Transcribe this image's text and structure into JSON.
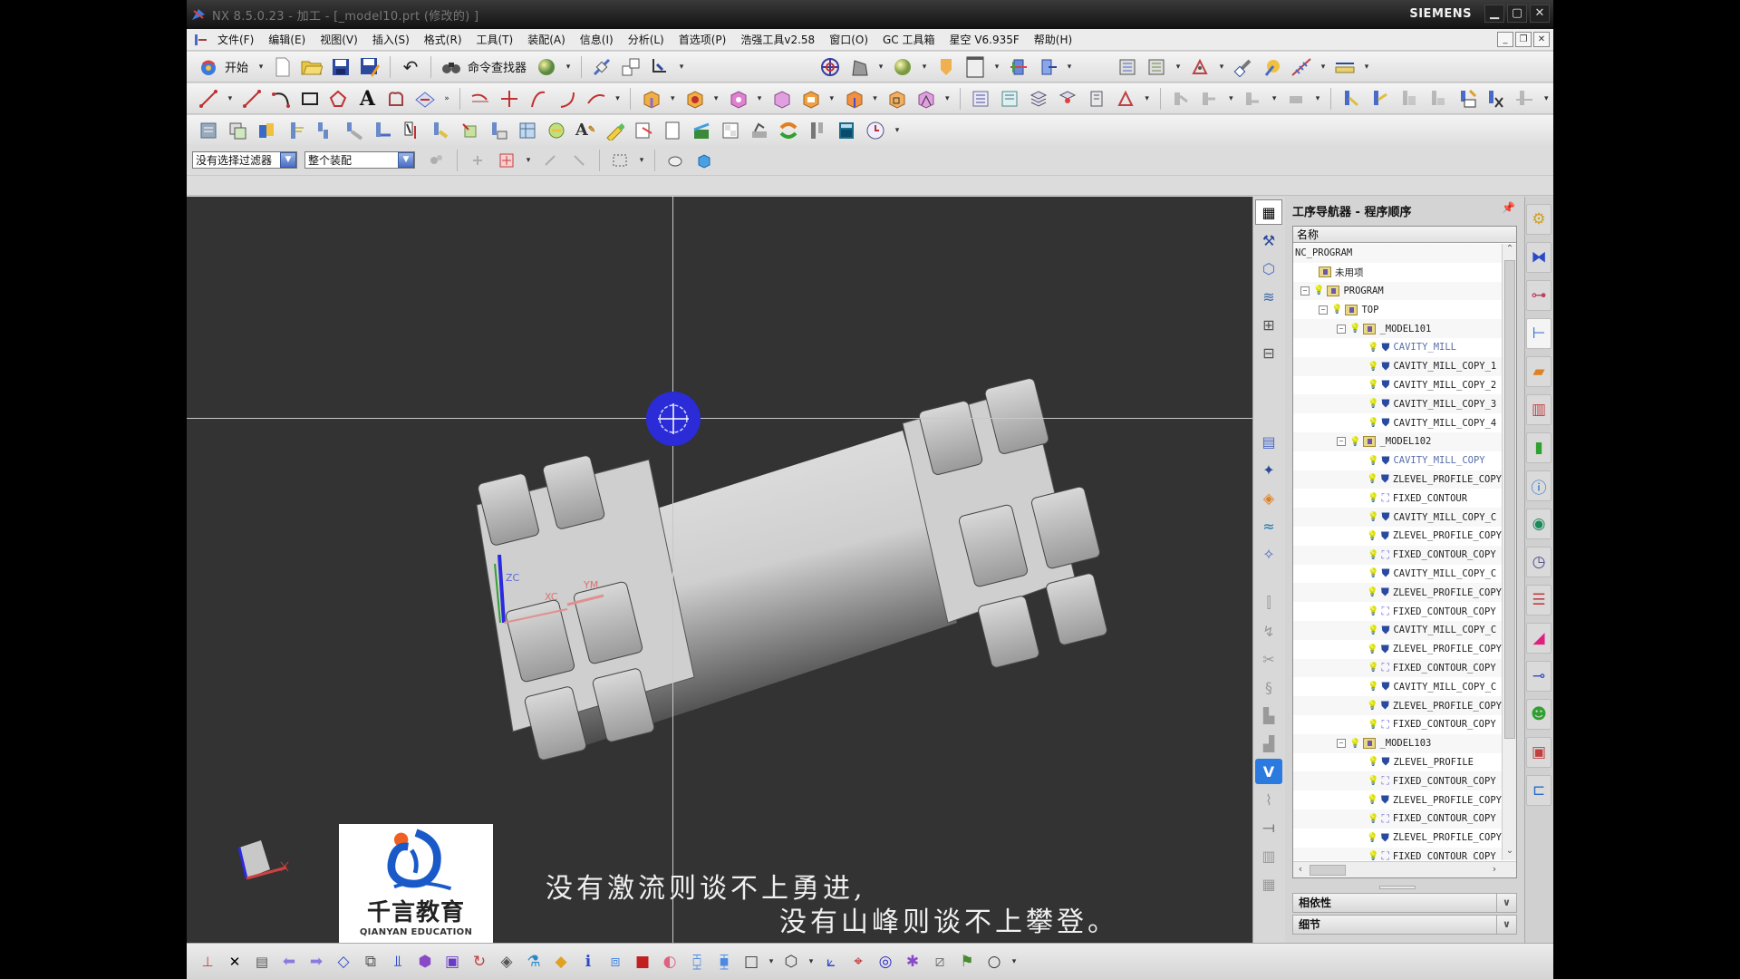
{
  "window": {
    "title": "NX 8.5.0.23 - 加工 - [_model10.prt  (修改的) ]",
    "brand": "SIEMENS",
    "controls": {
      "minimize": "▁",
      "maximize": "▢",
      "close": "✕"
    },
    "doc_controls": {
      "minimize": "_",
      "restore": "❐",
      "close": "✕"
    }
  },
  "menu": {
    "items": [
      "文件(F)",
      "编辑(E)",
      "视图(V)",
      "插入(S)",
      "格式(R)",
      "工具(T)",
      "装配(A)",
      "信息(I)",
      "分析(L)",
      "首选项(P)",
      "浩强工具v2.58",
      "窗口(O)",
      "GC 工具箱",
      "星空 V6.935F",
      "帮助(H)"
    ]
  },
  "toolbar": {
    "start_label": "开始",
    "command_finder_label": "命令查找器",
    "row1_icons": [
      "new-file",
      "open-folder",
      "save",
      "save-as",
      "undo"
    ],
    "row1_right_icons": [
      "rotate-view",
      "render-style",
      "shaded-sphere",
      "background",
      "layer-window",
      "fit-view",
      "section-view",
      "operation-list",
      "tool-list",
      "geometry-view",
      "measure"
    ],
    "row2_icons": [
      "line",
      "line-2",
      "arc",
      "rectangle",
      "polygon",
      "text",
      "offset-curve",
      "project-curve",
      "trim",
      "extend",
      "fillet",
      "curve-edit"
    ],
    "row3_icons": [
      "create-program",
      "create-tool",
      "create-geometry",
      "create-method",
      "create-operation",
      "generate-path",
      "verify",
      "post-process",
      "shop-doc"
    ]
  },
  "filterbar": {
    "selection_filter": "没有选择过滤器",
    "scope": "整个装配"
  },
  "viewport": {
    "subtitle_line1": "没有激流则谈不上勇进,",
    "subtitle_line2": "没有山峰则谈不上攀登。",
    "logo_cn": "千言教育",
    "logo_en": "QIANYAN EDUCATION",
    "axis_labels": {
      "zc": "ZC",
      "xc": "XC",
      "ym": "YM"
    }
  },
  "navigator": {
    "title": "工序导航器 - 程序顺序",
    "column_header": "名称",
    "rows": [
      {
        "indent": 0,
        "label": "NC_PROGRAM",
        "type": "root"
      },
      {
        "indent": 1,
        "label": "未用项",
        "type": "folder-unused"
      },
      {
        "indent": 0,
        "label": "PROGRAM",
        "type": "folder",
        "expand": "⊟"
      },
      {
        "indent": 1,
        "label": "TOP",
        "type": "folder",
        "expand": "⊟"
      },
      {
        "indent": 2,
        "label": "_MODEL101",
        "type": "folder",
        "expand": "⊟"
      },
      {
        "indent": 3,
        "label": "CAVITY_MILL",
        "type": "cavity",
        "selected": true
      },
      {
        "indent": 3,
        "label": "CAVITY_MILL_COPY_1",
        "type": "cavity"
      },
      {
        "indent": 3,
        "label": "CAVITY_MILL_COPY_2",
        "type": "cavity"
      },
      {
        "indent": 3,
        "label": "CAVITY_MILL_COPY_3",
        "type": "cavity"
      },
      {
        "indent": 3,
        "label": "CAVITY_MILL_COPY_4",
        "type": "cavity"
      },
      {
        "indent": 2,
        "label": "_MODEL102",
        "type": "folder",
        "expand": "⊟"
      },
      {
        "indent": 3,
        "label": "CAVITY_MILL_COPY",
        "type": "cavity",
        "selected": true
      },
      {
        "indent": 3,
        "label": "ZLEVEL_PROFILE_COPY",
        "type": "zlevel"
      },
      {
        "indent": 3,
        "label": "FIXED_CONTOUR",
        "type": "contour"
      },
      {
        "indent": 3,
        "label": "CAVITY_MILL_COPY_C",
        "type": "cavity"
      },
      {
        "indent": 3,
        "label": "ZLEVEL_PROFILE_COPY",
        "type": "zlevel"
      },
      {
        "indent": 3,
        "label": "FIXED_CONTOUR_COPY",
        "type": "contour"
      },
      {
        "indent": 3,
        "label": "CAVITY_MILL_COPY_C",
        "type": "cavity"
      },
      {
        "indent": 3,
        "label": "ZLEVEL_PROFILE_COPY",
        "type": "zlevel"
      },
      {
        "indent": 3,
        "label": "FIXED_CONTOUR_COPY",
        "type": "contour"
      },
      {
        "indent": 3,
        "label": "CAVITY_MILL_COPY_C",
        "type": "cavity"
      },
      {
        "indent": 3,
        "label": "ZLEVEL_PROFILE_COPY",
        "type": "zlevel"
      },
      {
        "indent": 3,
        "label": "FIXED_CONTOUR_COPY",
        "type": "contour"
      },
      {
        "indent": 3,
        "label": "CAVITY_MILL_COPY_C",
        "type": "cavity"
      },
      {
        "indent": 3,
        "label": "ZLEVEL_PROFILE_COPY",
        "type": "zlevel"
      },
      {
        "indent": 3,
        "label": "FIXED_CONTOUR_COPY",
        "type": "contour"
      },
      {
        "indent": 2,
        "label": "_MODEL103",
        "type": "folder",
        "expand": "⊟"
      },
      {
        "indent": 3,
        "label": "ZLEVEL_PROFILE",
        "type": "zlevel"
      },
      {
        "indent": 3,
        "label": "FIXED_CONTOUR_COPY",
        "type": "contour"
      },
      {
        "indent": 3,
        "label": "ZLEVEL_PROFILE_COPY",
        "type": "zlevel"
      },
      {
        "indent": 3,
        "label": "FIXED_CONTOUR_COPY",
        "type": "contour"
      },
      {
        "indent": 3,
        "label": "ZLEVEL_PROFILE_COPY",
        "type": "zlevel"
      },
      {
        "indent": 3,
        "label": "FIXED_CONTOUR_COPY",
        "type": "contour"
      }
    ],
    "panels": [
      "相依性",
      "细节"
    ]
  },
  "accent": {
    "selection_blue": "#5a6ea8",
    "bulb": "#e8c820",
    "viewport_bg": "#333333",
    "rotate_handle": "#2b2bd8"
  }
}
